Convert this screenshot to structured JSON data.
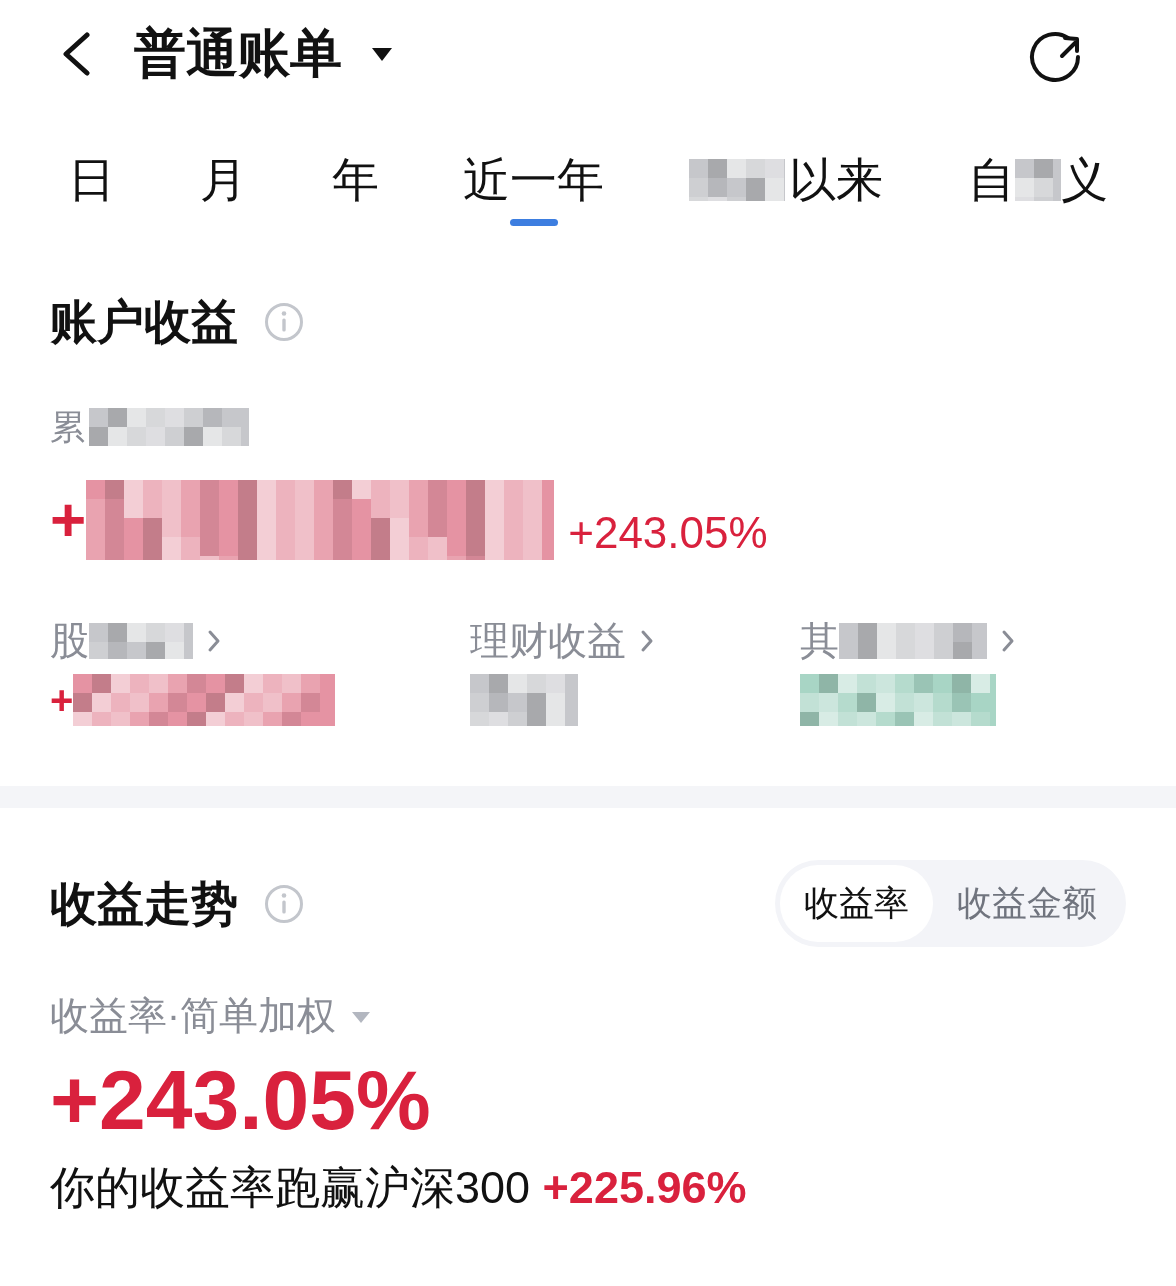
{
  "header": {
    "title": "普通账单"
  },
  "period_tabs": [
    {
      "segments": [
        {
          "kind": "text",
          "text": "日"
        }
      ],
      "selected": false
    },
    {
      "segments": [
        {
          "kind": "text",
          "text": "月"
        }
      ],
      "selected": false
    },
    {
      "segments": [
        {
          "kind": "text",
          "text": "年"
        }
      ],
      "selected": false
    },
    {
      "segments": [
        {
          "kind": "text",
          "text": "近一年"
        }
      ],
      "selected": true
    },
    {
      "segments": [
        {
          "kind": "mosaic",
          "color": "#c6c7cb"
        },
        {
          "kind": "text",
          "text": "以来"
        }
      ],
      "selected": false
    },
    {
      "segments": [
        {
          "kind": "text",
          "text": "自"
        },
        {
          "kind": "mosaic",
          "color": "#c6c7cb"
        },
        {
          "kind": "text",
          "text": "义"
        }
      ],
      "selected": false
    }
  ],
  "account_income": {
    "title": "账户收益",
    "total_label": [
      {
        "kind": "text",
        "text": "累"
      },
      {
        "kind": "mosaic",
        "color": "#c6c7cb"
      }
    ],
    "total_amount": [
      {
        "kind": "text",
        "text": "+"
      },
      {
        "kind": "mosaic",
        "color": "#e593a3"
      }
    ],
    "total_rate": "+243.05%",
    "breakdown": [
      {
        "label": [
          {
            "kind": "text",
            "text": "股"
          },
          {
            "kind": "mosaic",
            "color": "#c6c7cb"
          }
        ],
        "value": [
          {
            "kind": "text",
            "text": "+"
          },
          {
            "kind": "mosaic",
            "color": "#e593a3"
          }
        ]
      },
      {
        "label": [
          {
            "kind": "text",
            "text": "理财收益"
          }
        ],
        "value": [
          {
            "kind": "mosaic",
            "color": "#c6c7cb"
          }
        ]
      },
      {
        "label": [
          {
            "kind": "text",
            "text": "其"
          },
          {
            "kind": "mosaic",
            "color": "#c6c7cb"
          }
        ],
        "value": [
          {
            "kind": "mosaic",
            "color": "#a8d5c5"
          }
        ]
      }
    ]
  },
  "income_trend": {
    "title": "收益走势",
    "toggle": [
      {
        "label": "收益率",
        "selected": true
      },
      {
        "label": "收益金额",
        "selected": false
      }
    ],
    "metric": "收益率·简单加权",
    "rate": "+243.05%",
    "comparison": "你的收益率跑赢沪深300 **+225.96%**"
  }
}
